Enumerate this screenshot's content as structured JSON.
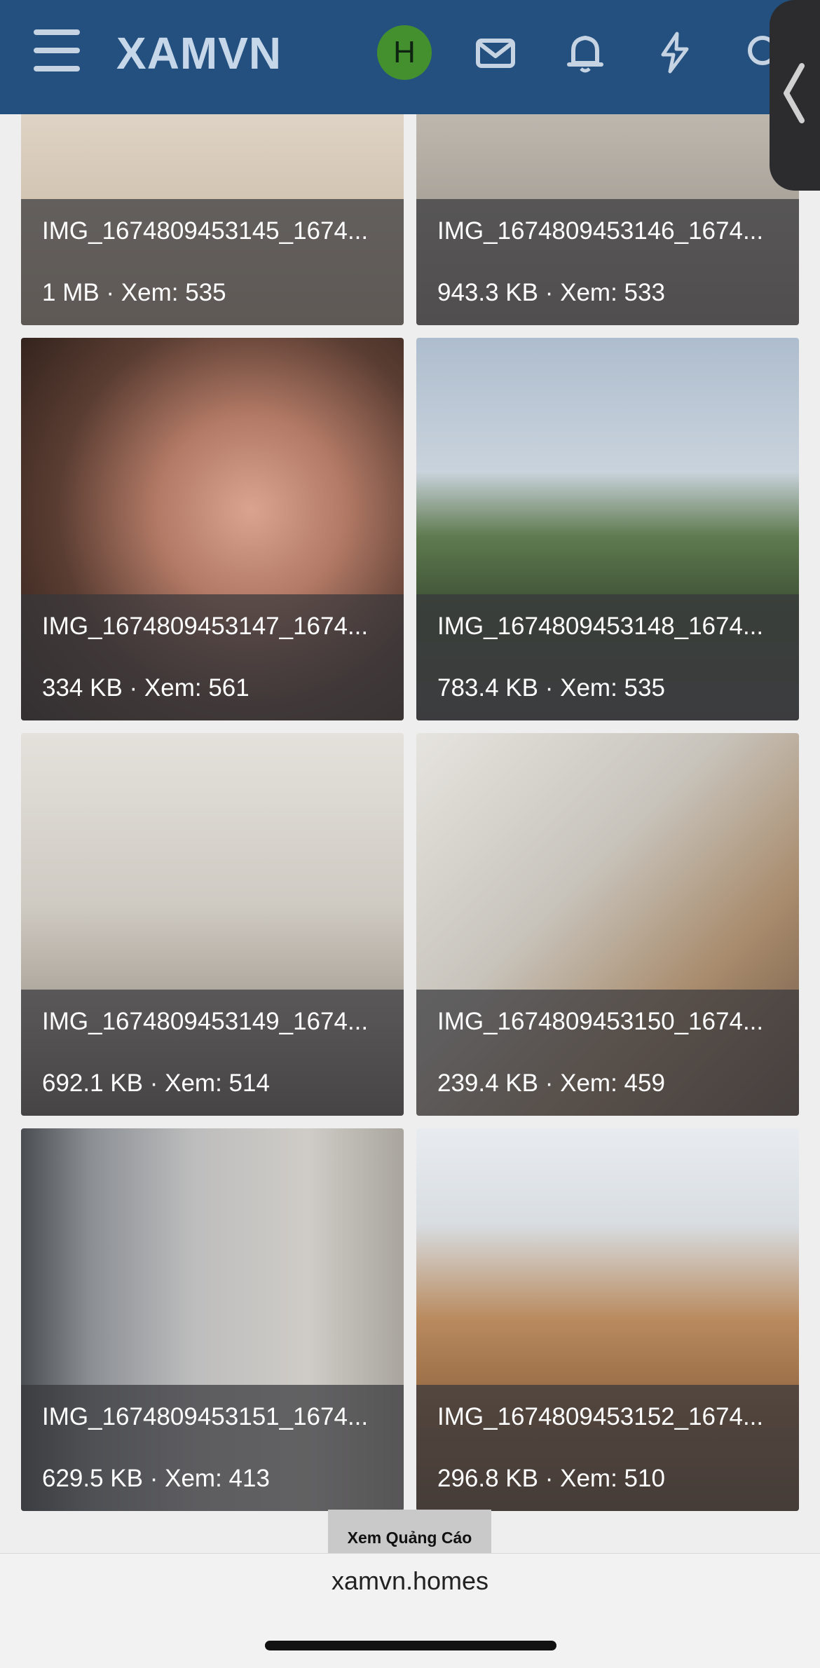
{
  "header": {
    "logo": "XAMVN",
    "avatar_letter": "H"
  },
  "gallery": [
    {
      "title": "IMG_1674809453145_1674...",
      "meta": "1 MB · Xem: 535"
    },
    {
      "title": "IMG_1674809453146_1674...",
      "meta": "943.3 KB · Xem: 533"
    },
    {
      "title": "IMG_1674809453147_1674...",
      "meta": "334 KB · Xem: 561"
    },
    {
      "title": "IMG_1674809453148_1674...",
      "meta": "783.4 KB · Xem: 535"
    },
    {
      "title": "IMG_1674809453149_1674...",
      "meta": "692.1 KB · Xem: 514"
    },
    {
      "title": "IMG_1674809453150_1674...",
      "meta": "239.4 KB · Xem: 459"
    },
    {
      "title": "IMG_1674809453151_1674...",
      "meta": "629.5 KB · Xem: 413"
    },
    {
      "title": "IMG_1674809453152_1674...",
      "meta": "296.8 KB · Xem: 510"
    }
  ],
  "ad_label": "Xem Quảng Cáo",
  "browser": {
    "domain": "xamvn.homes"
  },
  "colors": {
    "header_bg": "#23507f",
    "avatar_bg": "#44902f"
  }
}
